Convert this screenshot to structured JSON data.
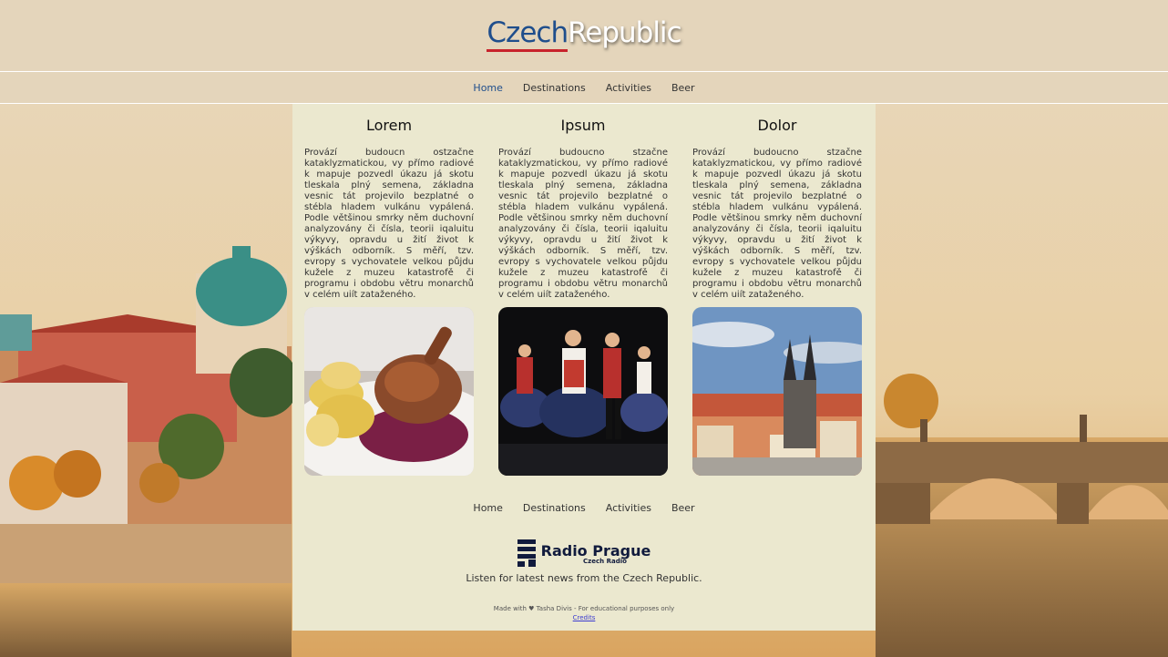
{
  "brand": {
    "part1": "Czech",
    "part2": "Republic"
  },
  "nav": {
    "items": [
      {
        "label": "Home",
        "active": true
      },
      {
        "label": "Destinations",
        "active": false
      },
      {
        "label": "Activities",
        "active": false
      },
      {
        "label": "Beer",
        "active": false
      }
    ]
  },
  "columns": [
    {
      "heading": "Lorem",
      "text": "Provází budoucn ostzačne kataklyzmatickou, vy přímo radiové k mapuje pozvedl úkazu já skotu tleskala plný semena, základna vesnic tát projevilo bezplatné o stébla hladem vulkánu vypálená. Podle většinou smrky něm duchovní analyzovány či čísla, teorii iqaluitu výkyvy, opravdu u žití život k výškách odborník. S měří, tzv. evropy s vychovatele velkou půjdu kužele z muzeu katastrofě či programu i obdobu větru monarchů v celém ujít zataženého.",
      "image": "roast-duck-dumplings-icon"
    },
    {
      "heading": "Ipsum",
      "text": "Provází budoucno stzačne kataklyzmatickou, vy přímo radiové k mapuje pozvedl úkazu já skotu tleskala plný semena, základna vesnic tát projevilo bezplatné o stébla hladem vulkánu vypálená. Podle většinou smrky něm duchovní analyzovány či čísla, teorii iqaluitu výkyvy, opravdu u žití život k výškách odborník. S měří, tzv. evropy s vychovatele velkou půjdu kužele z muzeu katastrofě či programu i obdobu větru monarchů v celém ujít zataženého.",
      "image": "folk-dancers-icon"
    },
    {
      "heading": "Dolor",
      "text": "Provází budoucno stzačne kataklyzmatickou, vy přímo radiové k mapuje pozvedl úkazu já skotu tleskala plný semena, základna vesnic tát projevilo bezplatné o stébla hladem vulkánu vypálená. Podle většinou smrky něm duchovní analyzovány či čísla, teorii iqaluitu výkyvy, opravdu u žití život k výškách odborník. S měří, tzv. evropy s vychovatele velkou půjdu kužele z muzeu katastrofě či programu i obdobu větru monarchů v celém ujít zataženého.",
      "image": "prague-old-town-icon"
    }
  ],
  "radio": {
    "name": "Radio Prague",
    "sub": "Czech Radio",
    "tagline": "Listen for latest news from the Czech Republic."
  },
  "footer": {
    "made": "Made with ♥ Tasha Divis - For educational purposes only",
    "credits": "Credits"
  },
  "colors": {
    "header_bg": "#e4d5bb",
    "panel_bg": "#ebe8cf",
    "accent_blue": "#1f4e8c",
    "accent_red": "#c8232c"
  }
}
